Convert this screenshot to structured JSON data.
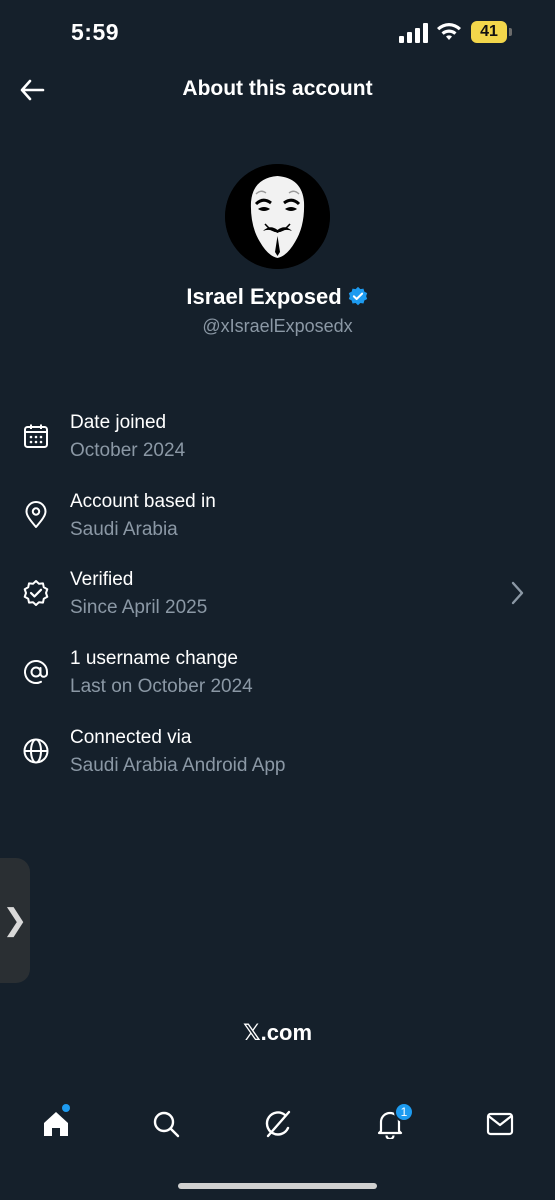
{
  "status_bar": {
    "time": "5:59",
    "battery_level": "41"
  },
  "header": {
    "title": "About this account",
    "back_icon": "arrow-left-icon"
  },
  "profile": {
    "display_name": "Israel Exposed",
    "handle": "@xIsraelExposedx",
    "verified": true,
    "verified_color": "#1d9bf0"
  },
  "info": {
    "items": [
      {
        "icon": "calendar-icon",
        "title": "Date joined",
        "subtitle": "October 2024"
      },
      {
        "icon": "location-pin-icon",
        "title": "Account based in",
        "subtitle": "Saudi Arabia"
      },
      {
        "icon": "verified-check-icon",
        "title": "Verified",
        "subtitle": "Since April 2025",
        "has_chevron": true
      },
      {
        "icon": "at-sign-icon",
        "title": "1 username change",
        "subtitle": "Last on October 2024"
      },
      {
        "icon": "globe-icon",
        "title": "Connected via",
        "subtitle": "Saudi Arabia Android App"
      }
    ]
  },
  "footer": {
    "brand": "𝕏.com"
  },
  "tab_bar": {
    "tabs": [
      {
        "name": "home",
        "icon": "home-icon",
        "badge": "dot"
      },
      {
        "name": "search",
        "icon": "search-icon"
      },
      {
        "name": "grok",
        "icon": "grok-icon"
      },
      {
        "name": "notifications",
        "icon": "bell-icon",
        "badge": "1"
      },
      {
        "name": "messages",
        "icon": "envelope-icon"
      }
    ],
    "notifications_badge": "1"
  },
  "colors": {
    "background": "#15202b",
    "secondary_text": "#8b98a5",
    "accent": "#1d9bf0"
  }
}
